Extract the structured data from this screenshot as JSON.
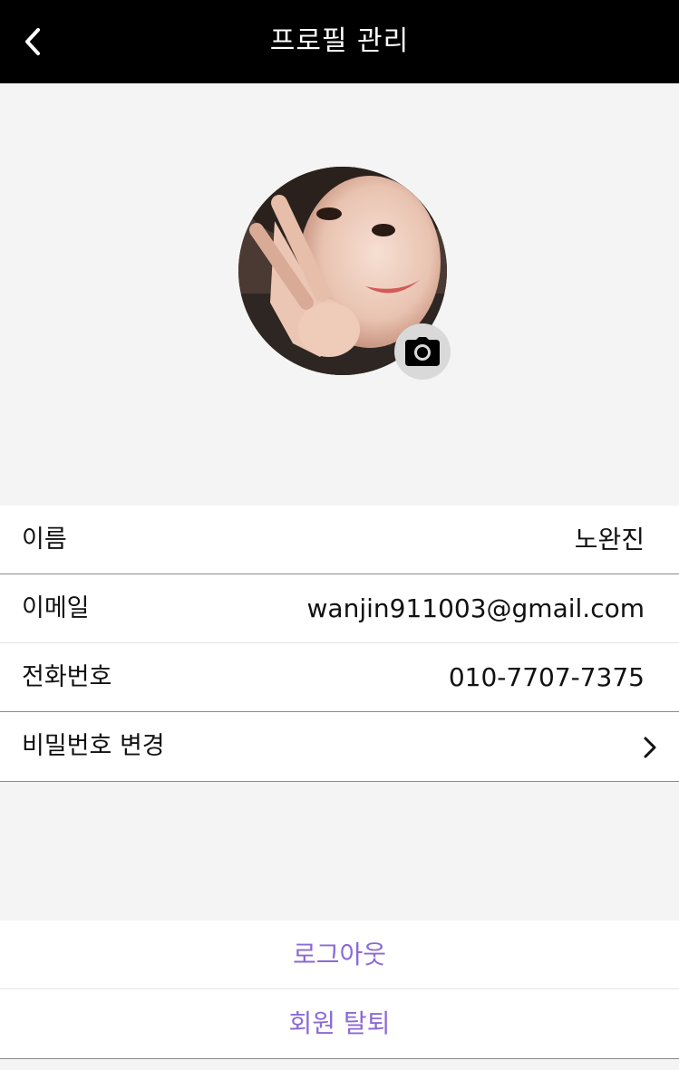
{
  "header": {
    "title": "프로필 관리",
    "back_icon": "chevron-left-icon"
  },
  "profile": {
    "camera_icon": "camera-icon"
  },
  "info": {
    "rows": [
      {
        "label": "이름",
        "value": "노완진"
      },
      {
        "label": "이메일",
        "value": "wanjin911003@gmail.com"
      },
      {
        "label": "전화번호",
        "value": "010-7707-7375"
      },
      {
        "label": "비밀번호 변경",
        "icon": "chevron-right-icon"
      }
    ]
  },
  "actions": {
    "logout_label": "로그아웃",
    "withdraw_label": "회원 탈퇴"
  },
  "colors": {
    "header_bg": "#000000",
    "page_bg": "#f4f4f4",
    "accent": "#8b6ad6"
  }
}
